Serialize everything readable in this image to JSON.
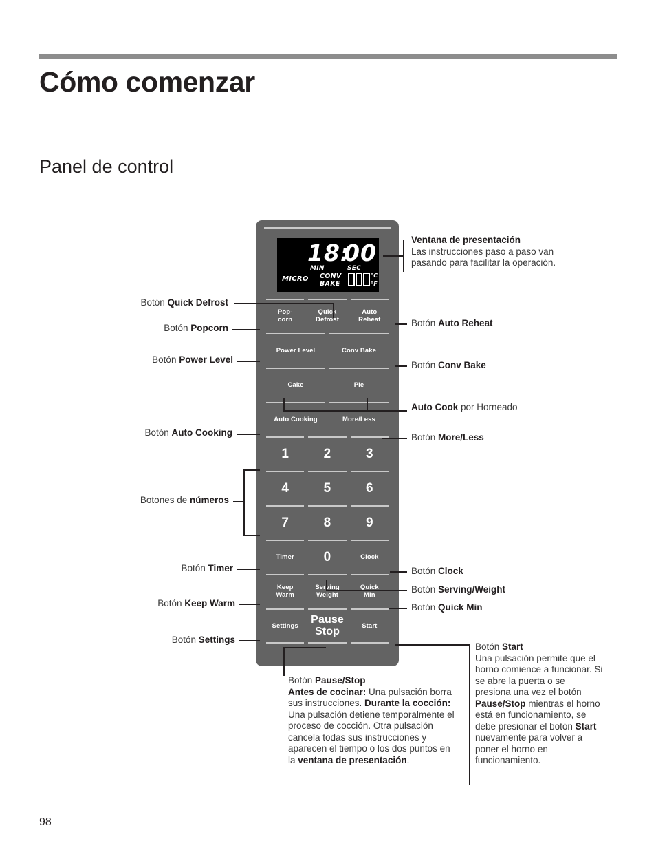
{
  "page": {
    "title": "Cómo comenzar",
    "section": "Panel de control",
    "number": "98"
  },
  "display": {
    "minutes": "18:",
    "seconds": "00",
    "min_label": "MIN",
    "sec_label": "SEC",
    "micro_label": "MICRO",
    "conv_label": "CONV",
    "bake_label": "BAKE",
    "celsius_label": "°C",
    "fahrenheit_label": "°F"
  },
  "panel_buttons": {
    "row1": [
      "Pop-\ncorn",
      "Quick\nDefrost",
      "Auto\nReheat"
    ],
    "row2": [
      "Power Level",
      "Conv Bake"
    ],
    "row3": [
      "Cake",
      "Pie"
    ],
    "row4": [
      "Auto Cooking",
      "More/Less"
    ],
    "row5": [
      "1",
      "2",
      "3"
    ],
    "row6": [
      "4",
      "5",
      "6"
    ],
    "row7": [
      "7",
      "8",
      "9"
    ],
    "row8": [
      "Timer",
      "0",
      "Clock"
    ],
    "row9": [
      "Keep\nWarm",
      "Serving\nWeight",
      "Quick\nMin"
    ],
    "row10": [
      "Settings",
      "Pause\nStop",
      "Start"
    ]
  },
  "callouts_left": {
    "quick_defrost": {
      "prefix": "Botón ",
      "name": "Quick Defrost"
    },
    "popcorn": {
      "prefix": "Botón ",
      "name": "Popcorn"
    },
    "power_level": {
      "prefix": "Botón ",
      "name": "Power Level"
    },
    "auto_cooking": {
      "prefix": "Botón ",
      "name": "Auto Cooking"
    },
    "numeros": {
      "prefix": "Botones de ",
      "name": "números"
    },
    "timer": {
      "prefix": "Botón ",
      "name": "Timer"
    },
    "keep_warm": {
      "prefix": "Botón ",
      "name": "Keep Warm"
    },
    "settings": {
      "prefix": "Botón ",
      "name": "Settings"
    }
  },
  "callouts_right": {
    "ventana": {
      "heading": "Ventana de presentación",
      "body": "Las instrucciones paso a paso van pasando para facilitar la operación."
    },
    "auto_reheat": {
      "prefix": "Botón ",
      "name": "Auto Reheat"
    },
    "conv_bake": {
      "prefix": "Botón ",
      "name": "Conv Bake"
    },
    "auto_cook": {
      "name": "Auto Cook",
      "suffix": " por Horneado"
    },
    "more_less": {
      "prefix": "Botón ",
      "name": "More/Less"
    },
    "clock": {
      "prefix": "Botón ",
      "name": "Clock"
    },
    "serving_weight": {
      "prefix": "Botón ",
      "name": "Serving/Weight"
    },
    "quick_min": {
      "prefix": "Botón ",
      "name": "Quick Min"
    }
  },
  "pause_stop_block": {
    "line1_prefix": "Botón ",
    "line1_name": "Pause/Stop",
    "seg1_bold": "Antes de cocinar:",
    "seg1_text": " Una pulsación borra sus instrucciones. ",
    "seg2_bold": "Durante la cocción:",
    "seg2_text": " Una pulsación detiene temporalmente el proceso de cocción. Otra pulsación cancela todas sus instrucciones y aparecen el tiempo o los dos puntos en la ",
    "seg3_bold": "ventana de presentación",
    "seg3_text": "."
  },
  "start_block": {
    "line1_prefix": "Botón ",
    "line1_name": "Start",
    "text1": "Una pulsación permite que el horno comience a funcionar. Si se abre la puerta o se presiona una vez el botón ",
    "bold1": "Pause/Stop",
    "text2": " mientras el horno está en funcionamiento, se debe presionar el botón ",
    "bold2": "Start",
    "text3": " nuevamente para volver a poner el horno en funcionamiento."
  },
  "colors": {
    "panel": "#636363",
    "rule": "#8d8d8d",
    "lcd_background": "#000000",
    "lcd_text": "#ffffff"
  }
}
